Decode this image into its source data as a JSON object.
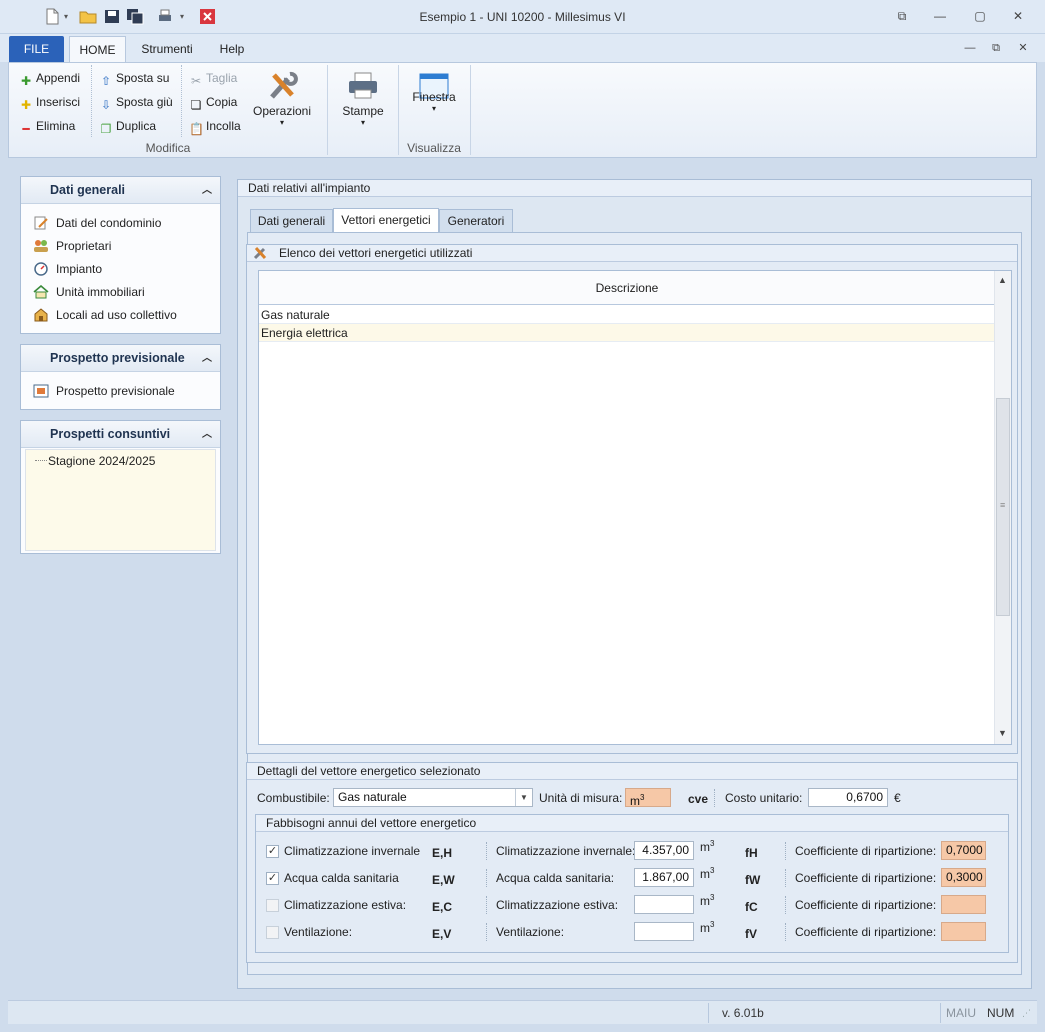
{
  "window": {
    "title": "Esempio 1 - UNI 10200 - Millesimus VI"
  },
  "ribbon_tabs": [
    "FILE",
    "HOME",
    "Strumenti",
    "Help"
  ],
  "ribbon": {
    "modifica": {
      "appendi": "Appendi",
      "inserisci": "Inserisci",
      "elimina": "Elimina",
      "sposta_su": "Sposta su",
      "sposta_giu": "Sposta giù",
      "duplica": "Duplica",
      "taglia": "Taglia",
      "copia": "Copia",
      "incolla": "Incolla",
      "operazioni": "Operazioni",
      "label": "Modifica"
    },
    "stampe": {
      "label": "Stampe"
    },
    "visualizza": {
      "finestra": "Finestra",
      "label": "Visualizza"
    }
  },
  "sidebar": {
    "dati_generali": {
      "title": "Dati generali",
      "items": [
        "Dati del condominio",
        "Proprietari",
        "Impianto",
        "Unità immobiliari",
        "Locali ad uso collettivo"
      ]
    },
    "prospetto_previsionale": {
      "title": "Prospetto previsionale",
      "items": [
        "Prospetto previsionale"
      ]
    },
    "prospetti_consuntivi": {
      "title": "Prospetti consuntivi",
      "items": [
        "Stagione 2024/2025"
      ]
    }
  },
  "main": {
    "title": "Dati relativi all'impianto",
    "tabs": [
      "Dati generali",
      "Vettori energetici",
      "Generatori"
    ],
    "active_tab": "Vettori energetici",
    "list": {
      "title": "Elenco dei vettori energetici utilizzati",
      "column": "Descrizione",
      "rows": [
        "Gas naturale",
        "Energia elettrica"
      ]
    },
    "details": {
      "title": "Dettagli del vettore energetico selezionato",
      "combustibile_label": "Combustibile:",
      "combustibile_value": "Gas naturale",
      "unita_label": "Unità di misura:",
      "unita_value": "m",
      "unita_sup": "3",
      "cve": "cve",
      "costo_label": "Costo unitario:",
      "costo_value": "0,6700",
      "costo_unit": "€",
      "fabbisogni": {
        "title": "Fabbisogni annui del vettore energetico",
        "rows": [
          {
            "check_label": "Climatizzazione invernale",
            "checked": true,
            "sym": "E,H",
            "qty_label": "Climatizzazione invernale:",
            "qty": "4.357,00",
            "unit": "m",
            "unit_sup": "3",
            "f": "fH",
            "coef_label": "Coefficiente di ripartizione:",
            "coef": "0,7000"
          },
          {
            "check_label": "Acqua calda sanitaria",
            "checked": true,
            "sym": "E,W",
            "qty_label": "Acqua calda sanitaria:",
            "qty": "1.867,00",
            "unit": "m",
            "unit_sup": "3",
            "f": "fW",
            "coef_label": "Coefficiente di ripartizione:",
            "coef": "0,3000"
          },
          {
            "check_label": "Climatizzazione estiva:",
            "checked": false,
            "sym": "E,C",
            "qty_label": "Climatizzazione estiva:",
            "qty": "",
            "unit": "m",
            "unit_sup": "3",
            "f": "fC",
            "coef_label": "Coefficiente di ripartizione:",
            "coef": ""
          },
          {
            "check_label": "Ventilazione:",
            "checked": false,
            "sym": "E,V",
            "qty_label": "Ventilazione:",
            "qty": "",
            "unit": "m",
            "unit_sup": "3",
            "f": "fV",
            "coef_label": "Coefficiente di ripartizione:",
            "coef": ""
          }
        ]
      }
    }
  },
  "statusbar": {
    "version": "v. 6.01b",
    "caps": "MAIU",
    "num": "NUM"
  },
  "colors": {
    "file_tab": "#2b62b9",
    "peach_field": "#f6c8a7",
    "panel_bg": "#dde7f2"
  }
}
